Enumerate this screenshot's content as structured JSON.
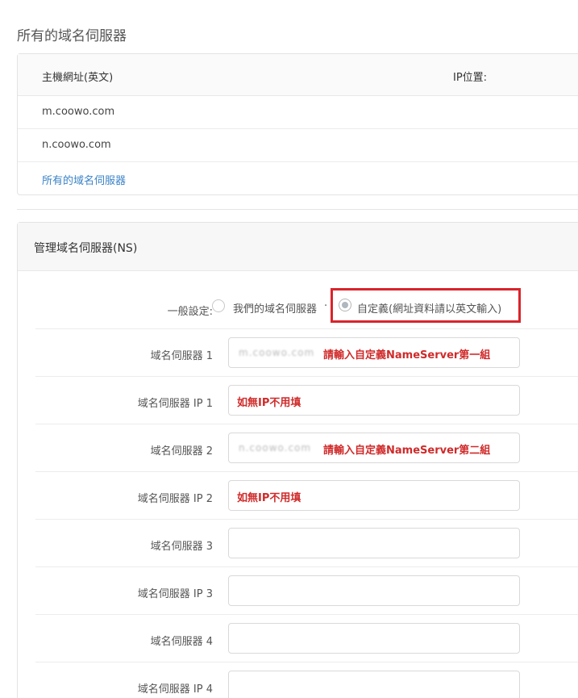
{
  "page": {
    "title": "所有的域名伺服器"
  },
  "nameserver_list": {
    "header_host": "主機網址(英文)",
    "header_ip": "IP位置:",
    "rows": [
      {
        "host": "m.coowo.com"
      },
      {
        "host": "n.coowo.com"
      }
    ],
    "all_link": "所有的域名伺服器"
  },
  "manage": {
    "title": "管理域名伺服器(NS)",
    "general_label": "一般設定:",
    "option_ours": "我們的域名伺服器",
    "option_separator": "·",
    "option_custom": "自定義(網址資料請以英文輸入)",
    "fields": [
      {
        "label": "域名伺服器 1",
        "value": "m.coowo.com",
        "note": "請輸入自定義NameServer第一組"
      },
      {
        "label": "域名伺服器 IP 1",
        "value": "",
        "note": "如無IP不用填"
      },
      {
        "label": "域名伺服器 2",
        "value": "n.coowo.com",
        "note": "請輸入自定義NameServer第二組"
      },
      {
        "label": "域名伺服器 IP 2",
        "value": "",
        "note": "如無IP不用填"
      },
      {
        "label": "域名伺服器 3",
        "value": "",
        "note": ""
      },
      {
        "label": "域名伺服器 IP 3",
        "value": "",
        "note": ""
      },
      {
        "label": "域名伺服器 4",
        "value": "",
        "note": ""
      },
      {
        "label": "域名伺服器 IP 4",
        "value": "",
        "note": ""
      }
    ]
  },
  "colors": {
    "link": "#3a83c7",
    "annotation_red": "#d02a2a",
    "highlight_border": "#d9242b"
  }
}
